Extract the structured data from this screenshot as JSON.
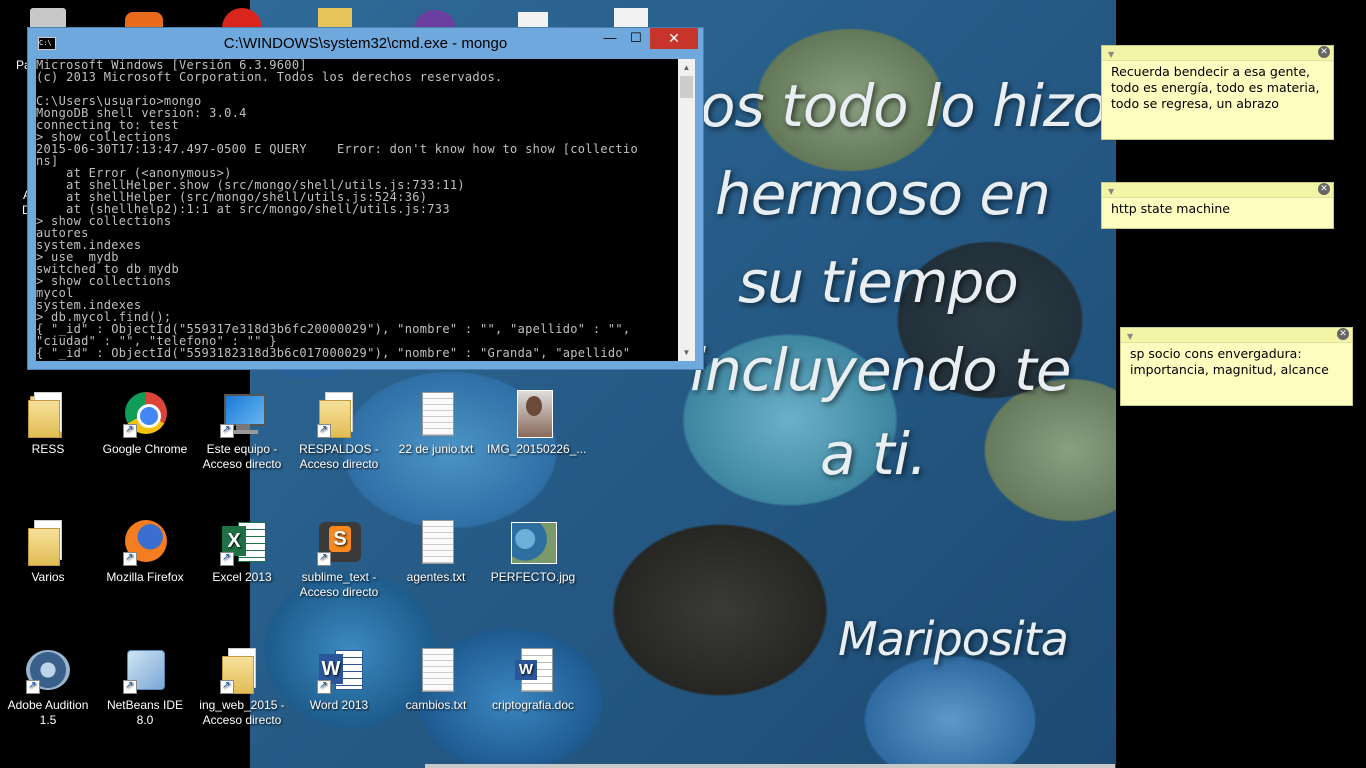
{
  "cmd": {
    "title": "C:\\WINDOWS\\system32\\cmd.exe - mongo",
    "minimize": "—",
    "maximize": "☐",
    "close": "✕",
    "output": "Microsoft Windows [Versión 6.3.9600]\n(c) 2013 Microsoft Corporation. Todos los derechos reservados.\n\nC:\\Users\\usuario>mongo\nMongoDB shell version: 3.0.4\nconnecting to: test\n> show collections\n2015-06-30T17:13:47.497-0500 E QUERY    Error: don't know how to show [collectio\nns]\n    at Error (<anonymous>)\n    at shellHelper.show (src/mongo/shell/utils.js:733:11)\n    at shellHelper (src/mongo/shell/utils.js:524:36)\n    at (shellhelp2):1:1 at src/mongo/shell/utils.js:733\n> show collections\nautores\nsystem.indexes\n> use  mydb\nswitched to db mydb\n> show collections\nmycol\nsystem.indexes\n> db.mycol.find();\n{ \"_id\" : ObjectId(\"559317e318d3b6fc20000029\"), \"nombre\" : \"\", \"apellido\" : \"\",\n\"ciudad\" : \"\", \"telefono\" : \"\" }\n{ \"_id\" : ObjectId(\"5593182318d3b6c017000029\"), \"nombre\" : \"Granda\", \"apellido\""
  },
  "wallpaper": {
    "lines": [
      "os todo lo hizo",
      "hermoso en",
      "su tiempo",
      "incluyendo te",
      "a ti.",
      "Mariposita"
    ]
  },
  "desktop_icons": [
    {
      "label": "RESS",
      "icon": "folder-icon"
    },
    {
      "label": "Google Chrome",
      "icon": "chrome-icon"
    },
    {
      "label": "Este equipo - Acceso directo",
      "icon": "computer-icon"
    },
    {
      "label": "RESPALDOS - Acceso directo",
      "icon": "folder-icon"
    },
    {
      "label": "22 de junio.txt",
      "icon": "text-file-icon"
    },
    {
      "label": "IMG_20150226_...",
      "icon": "photo-icon"
    },
    {
      "label": "Varios",
      "icon": "folder-icon"
    },
    {
      "label": "Mozilla Firefox",
      "icon": "firefox-icon"
    },
    {
      "label": "Excel 2013",
      "icon": "excel-icon"
    },
    {
      "label": "sublime_text - Acceso directo",
      "icon": "sublime-icon"
    },
    {
      "label": "agentes.txt",
      "icon": "text-file-icon"
    },
    {
      "label": "PERFECTO.jpg",
      "icon": "photo-icon"
    },
    {
      "label": "Adobe Audition 1.5",
      "icon": "audition-icon"
    },
    {
      "label": "NetBeans IDE 8.0",
      "icon": "netbeans-icon"
    },
    {
      "label": "ing_web_2015 - Acceso directo",
      "icon": "folder-icon"
    },
    {
      "label": "Word 2013",
      "icon": "word-icon"
    },
    {
      "label": "cambios.txt",
      "icon": "text-file-icon"
    },
    {
      "label": "criptografia.doc",
      "icon": "word-doc-icon"
    }
  ],
  "sticky_notes": [
    {
      "text": "Recuerda bendecir a esa gente, todo es energía, todo es materia, todo se regresa, un abrazo"
    },
    {
      "text": "http state machine"
    },
    {
      "text": "sp socio cons envergadura: importancia, magnitud, alcance"
    }
  ],
  "partial_labels": {
    "left_edge_1": "Pa",
    "left_edge_2": "A",
    "left_edge_3": "D"
  }
}
